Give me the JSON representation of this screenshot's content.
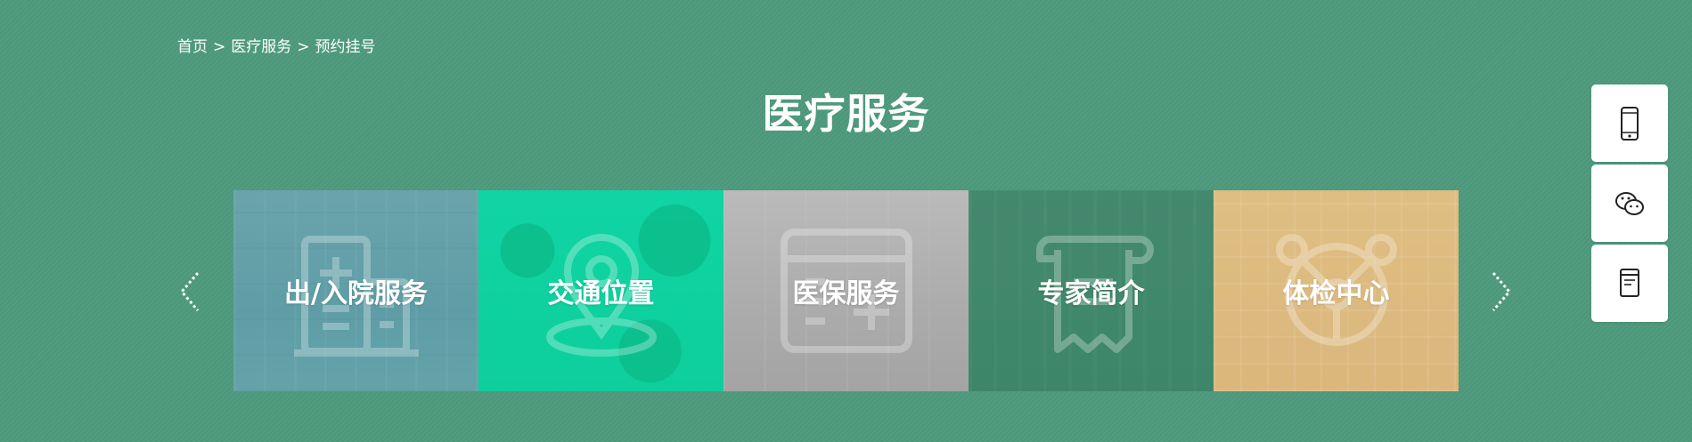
{
  "breadcrumb": {
    "home": "首页",
    "separator": ">",
    "level2": "医疗服务",
    "current": "预约挂号"
  },
  "page_title": "医疗服务",
  "cards": [
    {
      "label": "出/入院服务",
      "icon": "hospital-building-icon",
      "tint": "#5fa0aa"
    },
    {
      "label": "交通位置",
      "icon": "location-pin-icon",
      "tint": "#0ed2a0"
    },
    {
      "label": "医保服务",
      "icon": "medical-card-icon",
      "tint": "#aaaaaa"
    },
    {
      "label": "专家简介",
      "icon": "scroll-certificate-icon",
      "tint": "#3c8769"
    },
    {
      "label": "体检中心",
      "icon": "checkup-network-icon",
      "tint": "#dcb97d"
    }
  ],
  "carousel_controls": {
    "prev_icon": "chevron-left-icon",
    "next_icon": "chevron-right-icon"
  },
  "side_toolbar": [
    {
      "icon": "mobile-phone-icon"
    },
    {
      "icon": "wechat-icon"
    },
    {
      "icon": "document-icon"
    }
  ],
  "colors": {
    "background": "#4e9a7d",
    "text": "#ffffff"
  }
}
